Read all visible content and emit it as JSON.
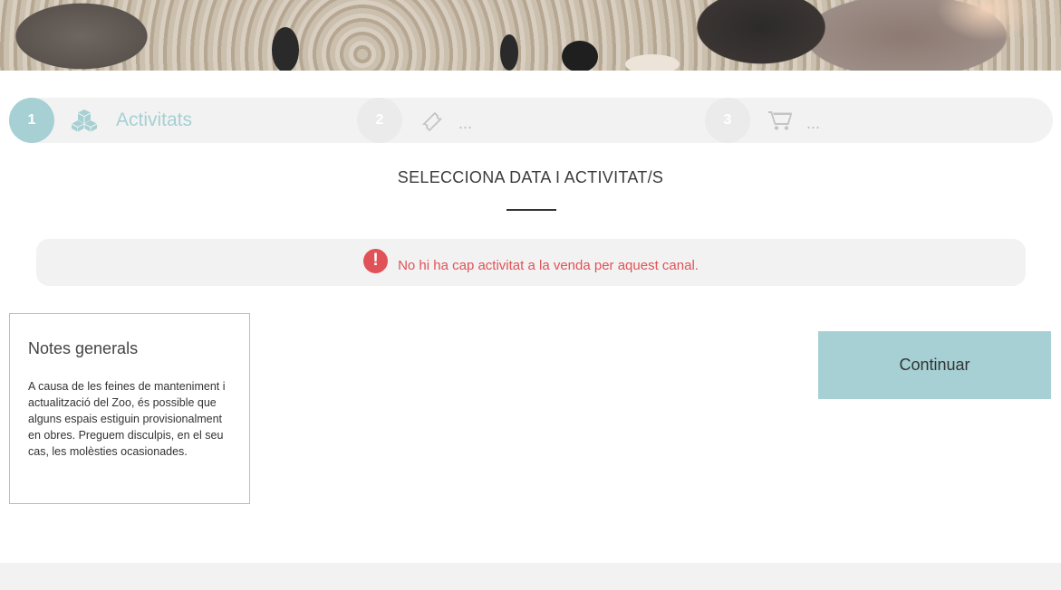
{
  "hero": {
    "alt": "Zoo banner photo with penguins on stones"
  },
  "steps": [
    {
      "number": "1",
      "icon": "cubes-icon",
      "label": "Activitats",
      "state": "active"
    },
    {
      "number": "2",
      "icon": "ticket-icon",
      "label": "...",
      "state": "inactive"
    },
    {
      "number": "3",
      "icon": "cart-icon",
      "label": "...",
      "state": "inactive"
    }
  ],
  "title": "SELECCIONA DATA I ACTIVITAT/S",
  "alert": {
    "icon": "exclamation-icon",
    "symbol": "!",
    "text": "No hi ha cap activitat a la venda per aquest canal."
  },
  "notes": {
    "title": "Notes generals",
    "body": "A causa de les feines de manteniment i actualització del Zoo, és possible que alguns espais estiguin provisionalment en obres. Preguem disculpis, en el seu cas, les molèsties ocasionades."
  },
  "continue_label": "Continuar",
  "colors": {
    "accent": "#a6d0d4",
    "error": "#e05258",
    "panel": "#f2f2f2"
  }
}
